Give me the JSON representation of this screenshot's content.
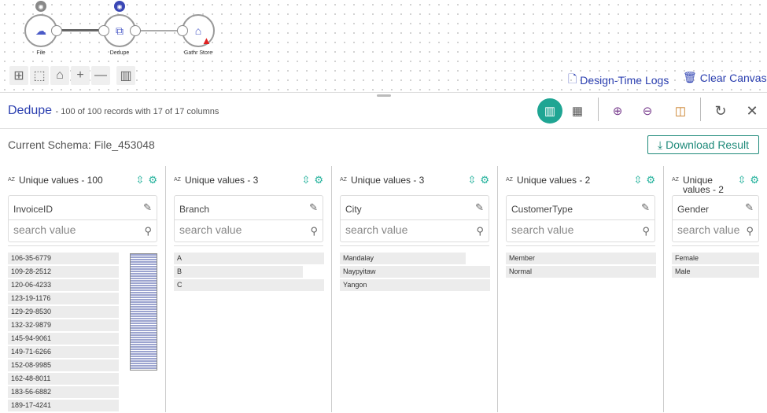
{
  "pipeline": {
    "nodes": [
      {
        "label": "File",
        "icon": "cloud-upload-icon"
      },
      {
        "label": "Dedupe",
        "icon": "dedupe-icon"
      },
      {
        "label": "Gathr Store",
        "icon": "store-icon",
        "warning": true
      }
    ]
  },
  "canvas_links": {
    "logs": "Design-Time Logs",
    "clear": "Clear Canvas"
  },
  "panel": {
    "title": "Dedupe",
    "subtitle": "- 100 of 100 records with 17 of 17 columns",
    "schema": "Current Schema: File_453048",
    "download": "Download Result"
  },
  "colors": {
    "accent": "#1fa593",
    "link": "#2b3fb0"
  },
  "columns": [
    {
      "header": "Unique values - 100",
      "field": "InvoiceID",
      "placeholder": "search value",
      "values": [
        "106-35-6779",
        "109-28-2512",
        "120-06-4233",
        "123-19-1176",
        "129-29-8530",
        "132-32-9879",
        "145-94-9061",
        "149-71-6266",
        "152-08-9985",
        "162-48-8011",
        "183-56-6882",
        "189-17-4241"
      ]
    },
    {
      "header": "Unique values - 3",
      "field": "Branch",
      "placeholder": "search value",
      "values": [
        "A",
        "B",
        "C"
      ],
      "bars": [
        100,
        86,
        100
      ]
    },
    {
      "header": "Unique values - 3",
      "field": "City",
      "placeholder": "search value",
      "values": [
        "Mandalay",
        "Naypyitaw",
        "Yangon"
      ],
      "bars": [
        84,
        100,
        100
      ]
    },
    {
      "header": "Unique values - 2",
      "field": "CustomerType",
      "placeholder": "search value",
      "values": [
        "Member",
        "Normal"
      ],
      "bars": [
        100,
        100
      ]
    },
    {
      "header": "Unique values - 2",
      "field": "Gender",
      "placeholder": "search value",
      "values": [
        "Female",
        "Male"
      ],
      "bars": [
        100,
        100
      ]
    }
  ]
}
